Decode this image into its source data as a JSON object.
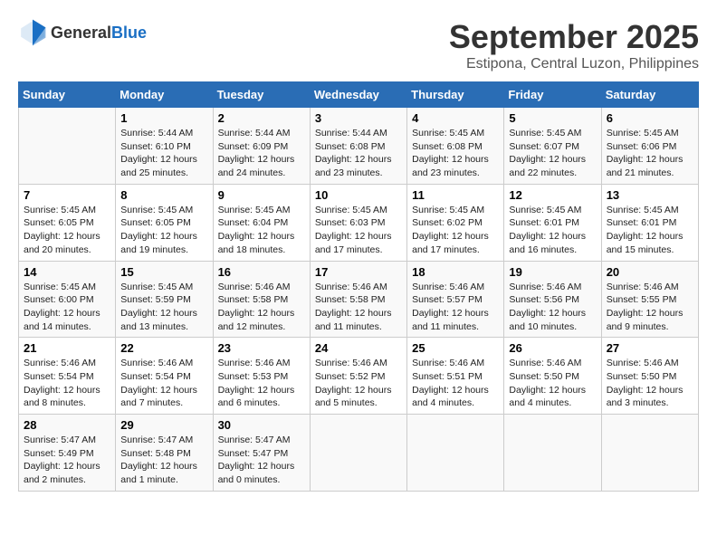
{
  "header": {
    "logo_general": "General",
    "logo_blue": "Blue",
    "month": "September 2025",
    "location": "Estipona, Central Luzon, Philippines"
  },
  "weekdays": [
    "Sunday",
    "Monday",
    "Tuesday",
    "Wednesday",
    "Thursday",
    "Friday",
    "Saturday"
  ],
  "weeks": [
    [
      {
        "day": "",
        "sunrise": "",
        "sunset": "",
        "daylight": "",
        "empty": true
      },
      {
        "day": "1",
        "sunrise": "Sunrise: 5:44 AM",
        "sunset": "Sunset: 6:10 PM",
        "daylight": "Daylight: 12 hours and 25 minutes."
      },
      {
        "day": "2",
        "sunrise": "Sunrise: 5:44 AM",
        "sunset": "Sunset: 6:09 PM",
        "daylight": "Daylight: 12 hours and 24 minutes."
      },
      {
        "day": "3",
        "sunrise": "Sunrise: 5:44 AM",
        "sunset": "Sunset: 6:08 PM",
        "daylight": "Daylight: 12 hours and 23 minutes."
      },
      {
        "day": "4",
        "sunrise": "Sunrise: 5:45 AM",
        "sunset": "Sunset: 6:08 PM",
        "daylight": "Daylight: 12 hours and 23 minutes."
      },
      {
        "day": "5",
        "sunrise": "Sunrise: 5:45 AM",
        "sunset": "Sunset: 6:07 PM",
        "daylight": "Daylight: 12 hours and 22 minutes."
      },
      {
        "day": "6",
        "sunrise": "Sunrise: 5:45 AM",
        "sunset": "Sunset: 6:06 PM",
        "daylight": "Daylight: 12 hours and 21 minutes."
      }
    ],
    [
      {
        "day": "7",
        "sunrise": "Sunrise: 5:45 AM",
        "sunset": "Sunset: 6:05 PM",
        "daylight": "Daylight: 12 hours and 20 minutes."
      },
      {
        "day": "8",
        "sunrise": "Sunrise: 5:45 AM",
        "sunset": "Sunset: 6:05 PM",
        "daylight": "Daylight: 12 hours and 19 minutes."
      },
      {
        "day": "9",
        "sunrise": "Sunrise: 5:45 AM",
        "sunset": "Sunset: 6:04 PM",
        "daylight": "Daylight: 12 hours and 18 minutes."
      },
      {
        "day": "10",
        "sunrise": "Sunrise: 5:45 AM",
        "sunset": "Sunset: 6:03 PM",
        "daylight": "Daylight: 12 hours and 17 minutes."
      },
      {
        "day": "11",
        "sunrise": "Sunrise: 5:45 AM",
        "sunset": "Sunset: 6:02 PM",
        "daylight": "Daylight: 12 hours and 17 minutes."
      },
      {
        "day": "12",
        "sunrise": "Sunrise: 5:45 AM",
        "sunset": "Sunset: 6:01 PM",
        "daylight": "Daylight: 12 hours and 16 minutes."
      },
      {
        "day": "13",
        "sunrise": "Sunrise: 5:45 AM",
        "sunset": "Sunset: 6:01 PM",
        "daylight": "Daylight: 12 hours and 15 minutes."
      }
    ],
    [
      {
        "day": "14",
        "sunrise": "Sunrise: 5:45 AM",
        "sunset": "Sunset: 6:00 PM",
        "daylight": "Daylight: 12 hours and 14 minutes."
      },
      {
        "day": "15",
        "sunrise": "Sunrise: 5:45 AM",
        "sunset": "Sunset: 5:59 PM",
        "daylight": "Daylight: 12 hours and 13 minutes."
      },
      {
        "day": "16",
        "sunrise": "Sunrise: 5:46 AM",
        "sunset": "Sunset: 5:58 PM",
        "daylight": "Daylight: 12 hours and 12 minutes."
      },
      {
        "day": "17",
        "sunrise": "Sunrise: 5:46 AM",
        "sunset": "Sunset: 5:58 PM",
        "daylight": "Daylight: 12 hours and 11 minutes."
      },
      {
        "day": "18",
        "sunrise": "Sunrise: 5:46 AM",
        "sunset": "Sunset: 5:57 PM",
        "daylight": "Daylight: 12 hours and 11 minutes."
      },
      {
        "day": "19",
        "sunrise": "Sunrise: 5:46 AM",
        "sunset": "Sunset: 5:56 PM",
        "daylight": "Daylight: 12 hours and 10 minutes."
      },
      {
        "day": "20",
        "sunrise": "Sunrise: 5:46 AM",
        "sunset": "Sunset: 5:55 PM",
        "daylight": "Daylight: 12 hours and 9 minutes."
      }
    ],
    [
      {
        "day": "21",
        "sunrise": "Sunrise: 5:46 AM",
        "sunset": "Sunset: 5:54 PM",
        "daylight": "Daylight: 12 hours and 8 minutes."
      },
      {
        "day": "22",
        "sunrise": "Sunrise: 5:46 AM",
        "sunset": "Sunset: 5:54 PM",
        "daylight": "Daylight: 12 hours and 7 minutes."
      },
      {
        "day": "23",
        "sunrise": "Sunrise: 5:46 AM",
        "sunset": "Sunset: 5:53 PM",
        "daylight": "Daylight: 12 hours and 6 minutes."
      },
      {
        "day": "24",
        "sunrise": "Sunrise: 5:46 AM",
        "sunset": "Sunset: 5:52 PM",
        "daylight": "Daylight: 12 hours and 5 minutes."
      },
      {
        "day": "25",
        "sunrise": "Sunrise: 5:46 AM",
        "sunset": "Sunset: 5:51 PM",
        "daylight": "Daylight: 12 hours and 4 minutes."
      },
      {
        "day": "26",
        "sunrise": "Sunrise: 5:46 AM",
        "sunset": "Sunset: 5:50 PM",
        "daylight": "Daylight: 12 hours and 4 minutes."
      },
      {
        "day": "27",
        "sunrise": "Sunrise: 5:46 AM",
        "sunset": "Sunset: 5:50 PM",
        "daylight": "Daylight: 12 hours and 3 minutes."
      }
    ],
    [
      {
        "day": "28",
        "sunrise": "Sunrise: 5:47 AM",
        "sunset": "Sunset: 5:49 PM",
        "daylight": "Daylight: 12 hours and 2 minutes."
      },
      {
        "day": "29",
        "sunrise": "Sunrise: 5:47 AM",
        "sunset": "Sunset: 5:48 PM",
        "daylight": "Daylight: 12 hours and 1 minute."
      },
      {
        "day": "30",
        "sunrise": "Sunrise: 5:47 AM",
        "sunset": "Sunset: 5:47 PM",
        "daylight": "Daylight: 12 hours and 0 minutes."
      },
      {
        "day": "",
        "sunrise": "",
        "sunset": "",
        "daylight": "",
        "empty": true
      },
      {
        "day": "",
        "sunrise": "",
        "sunset": "",
        "daylight": "",
        "empty": true
      },
      {
        "day": "",
        "sunrise": "",
        "sunset": "",
        "daylight": "",
        "empty": true
      },
      {
        "day": "",
        "sunrise": "",
        "sunset": "",
        "daylight": "",
        "empty": true
      }
    ]
  ]
}
